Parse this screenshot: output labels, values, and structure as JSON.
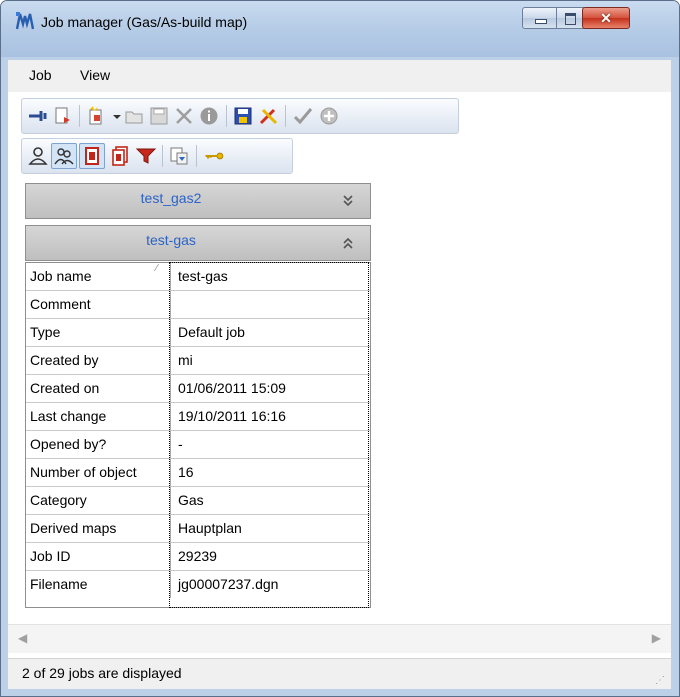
{
  "window": {
    "title": "Job manager (Gas/As-build map)",
    "close_glyph": "✕"
  },
  "menu": {
    "job": "Job",
    "view": "View"
  },
  "toolbar1": {
    "icons": [
      "pin-icon",
      "document-export-icon",
      "new-job-icon",
      "dropdown-arrow-icon",
      "open-icon",
      "save-icon",
      "delete-icon",
      "info-icon",
      "save-disk-icon",
      "tools-icon",
      "check-icon",
      "add-circle-icon"
    ]
  },
  "toolbar2": {
    "icons": [
      "user-icon",
      "users-icon",
      "document-red-icon",
      "documents-red-icon",
      "filter-icon",
      "copy-icon",
      "key-icon"
    ]
  },
  "groups": [
    {
      "title": "test_gas2",
      "chevron": "⌄⌄",
      "expanded": false
    },
    {
      "title": "test-gas",
      "chevron": "⌃⌃",
      "expanded": true
    }
  ],
  "properties": [
    {
      "key": "Job name",
      "value": "test-gas"
    },
    {
      "key": "Comment",
      "value": ""
    },
    {
      "key": "Type",
      "value": "Default job"
    },
    {
      "key": "Created by",
      "value": "mi"
    },
    {
      "key": "Created on",
      "value": "01/06/2011 15:09"
    },
    {
      "key": "Last change",
      "value": "19/10/2011 16:16"
    },
    {
      "key": "Opened by?",
      "value": "-"
    },
    {
      "key": "Number of object",
      "value": "16"
    },
    {
      "key": "Category",
      "value": "Gas"
    },
    {
      "key": "Derived maps",
      "value": "Hauptplan"
    },
    {
      "key": "Job ID",
      "value": "29239"
    },
    {
      "key": "Filename",
      "value": "jg00007237.dgn"
    }
  ],
  "status": {
    "text": "2 of 29 jobs are displayed"
  },
  "colors": {
    "group_title": "#2b63c9",
    "title_bar": "#b7cde7"
  }
}
